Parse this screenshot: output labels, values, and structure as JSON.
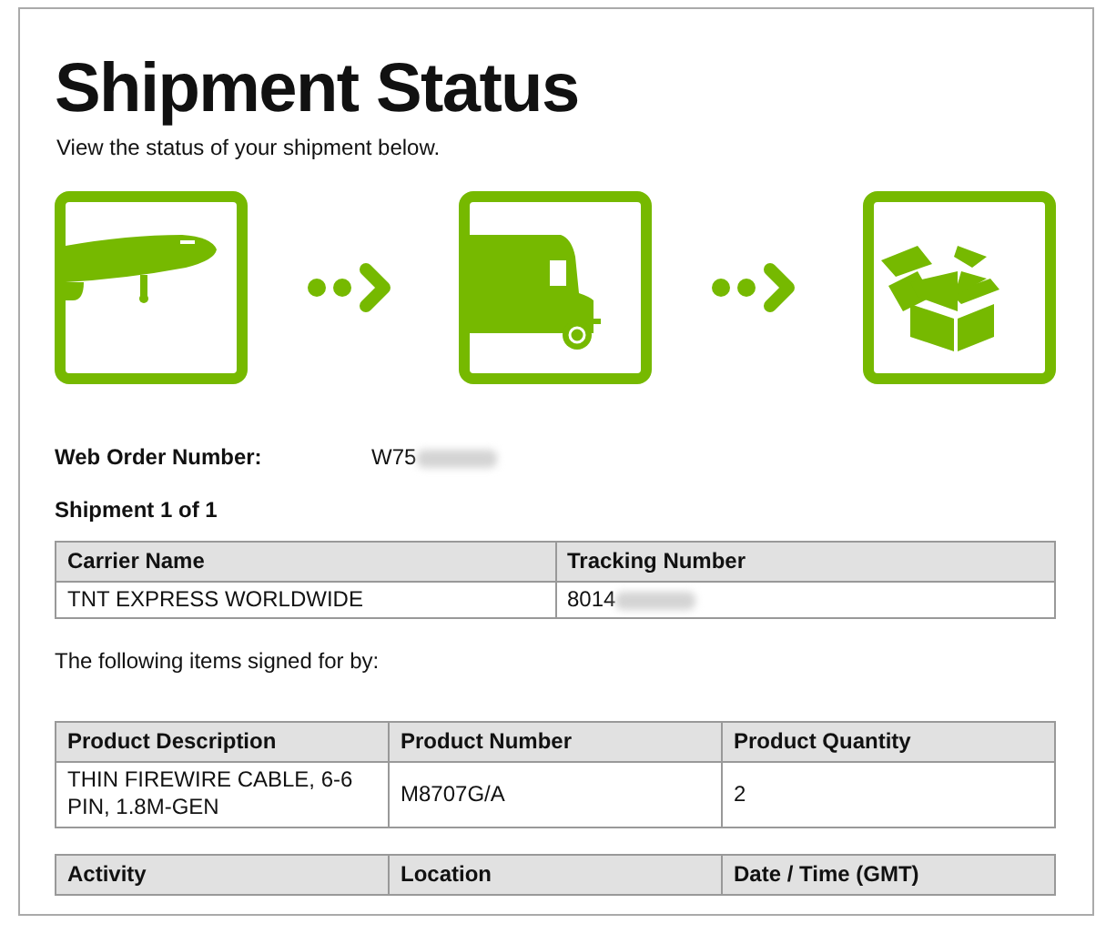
{
  "title": "Shipment Status",
  "subtitle": "View the status of your shipment below.",
  "steps": [
    {
      "kind": "plane"
    },
    {
      "kind": "truck"
    },
    {
      "kind": "box"
    }
  ],
  "order": {
    "label": "Web Order Number:",
    "value": "W75",
    "redacted": true
  },
  "shipment_heading": "Shipment 1 of 1",
  "tables": [
    {
      "columns": [
        "Carrier Name",
        "Tracking Number"
      ],
      "rows": [
        [
          {
            "text": "TNT EXPRESS WORLDWIDE"
          },
          {
            "text": "8014",
            "redacted": true
          }
        ]
      ]
    },
    {
      "note": "The following items signed for by:",
      "columns": [
        "Product Description",
        "Product Number",
        "Product Quantity"
      ],
      "rows": [
        [
          {
            "text": "THIN FIREWIRE CABLE, 6-6 PIN, 1.8M-GEN"
          },
          {
            "text": "M8707G/A"
          },
          {
            "text": "2"
          }
        ]
      ]
    },
    {
      "columns": [
        "Activity",
        "Location",
        "Date / Time (GMT)"
      ]
    }
  ]
}
